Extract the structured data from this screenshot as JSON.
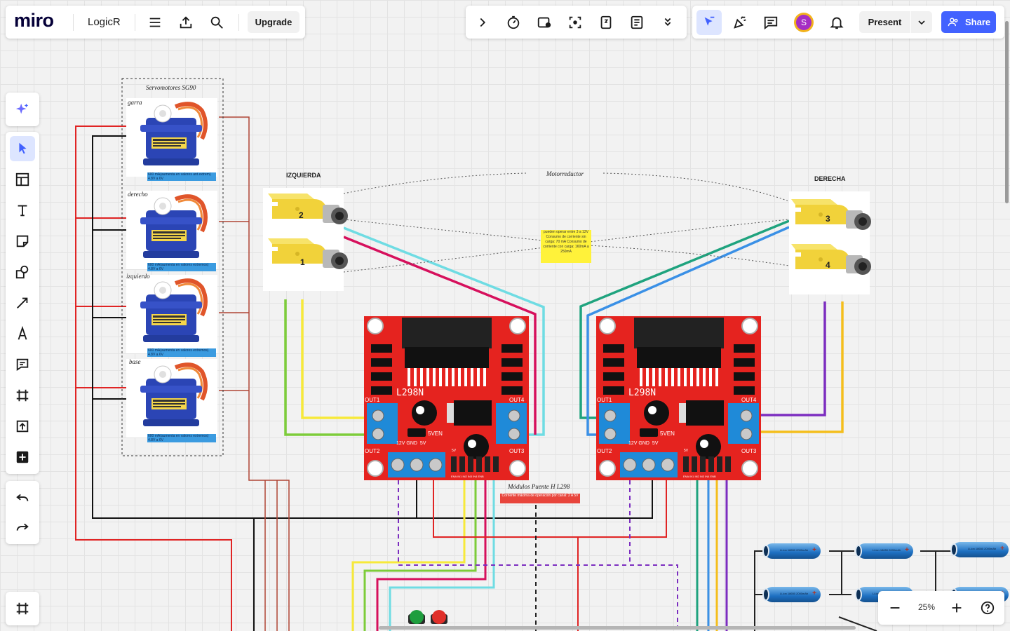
{
  "app": {
    "logo": "miro",
    "board_name": "LogicR",
    "upgrade_label": "Upgrade"
  },
  "toolbar_right": {
    "present_label": "Present",
    "share_label": "Share",
    "avatar_initial": "S"
  },
  "zoom": {
    "level": "25%"
  },
  "board": {
    "servo_group_title": "Servomotores SG90",
    "servos": [
      {
        "name": "garra",
        "note": "600 mA(aumenta en valores ant extrem) 4.8V a 6V"
      },
      {
        "name": "derecho",
        "note": "600 mA(aumenta en valores extremos) 4.8V a 6V"
      },
      {
        "name": "izquierdo",
        "note": "600 mA(aumenta en valores extremos) 4.8V a 6V"
      },
      {
        "name": "base",
        "note": "600 mA(aumenta en valores extremos) 4.8V a 6V"
      }
    ],
    "left_label": "IZQUIERDA",
    "right_label": "DERECHA",
    "motor_label": "Motorreductor",
    "motor_numbers": [
      "2",
      "1",
      "3",
      "4"
    ],
    "motor_note": "pueden operar entre 3 a 12V Consumo de corriente sin carga: 70 mA Consumo de corriente con carga: 160mA a 250mA",
    "bridge_label": "Módulos Puente H L298",
    "bridge_note": "Corriente máxima de operación por canal: 2 A 5V",
    "driver": {
      "chip": "L298N",
      "out1": "OUT1",
      "out2": "OUT2",
      "out3": "OUT3",
      "out4": "OUT4",
      "sven": "5VEN",
      "power": "12V GND  5V",
      "v5": "5V",
      "pins": "ENA IN1 IN2 IN3 IN4 ENB"
    },
    "battery_text": "Li-ion 18650 2000mAh"
  },
  "colors": {
    "accent": "#4262ff",
    "driver_red": "#e5231f",
    "terminal_blue": "#1f8ad8",
    "wire_red": "#e02424",
    "wire_yellow": "#f7e93a",
    "wire_green": "#7dcc3a",
    "wire_cyan": "#6fdce3",
    "wire_magenta": "#d6105c",
    "wire_teal": "#1fa37e",
    "wire_blue": "#3a90e6",
    "wire_purple": "#7c2ec0",
    "wire_orange": "#f4be1c",
    "wire_brown": "#b04535",
    "note_yellow": "#fff23a"
  },
  "icons": {
    "top": [
      "menu-icon",
      "export-icon",
      "search-icon"
    ],
    "right_toolbar": [
      "chevron-right-icon",
      "timer-icon",
      "screen-record-icon",
      "focus-icon",
      "card-icon",
      "notes-icon",
      "chevron-down-double-icon"
    ],
    "collab": [
      "cursor-select-icon",
      "reactions-icon",
      "comments-icon",
      "bell-icon"
    ],
    "left_tools": [
      "ai-sparkle-icon",
      "select-icon",
      "templates-icon",
      "text-icon",
      "sticky-note-icon",
      "shapes-icon",
      "connector-icon",
      "pen-icon",
      "comment-icon",
      "frame-icon",
      "upload-icon",
      "more-tools-icon",
      "undo-icon",
      "redo-icon",
      "frames-panel-icon"
    ]
  }
}
